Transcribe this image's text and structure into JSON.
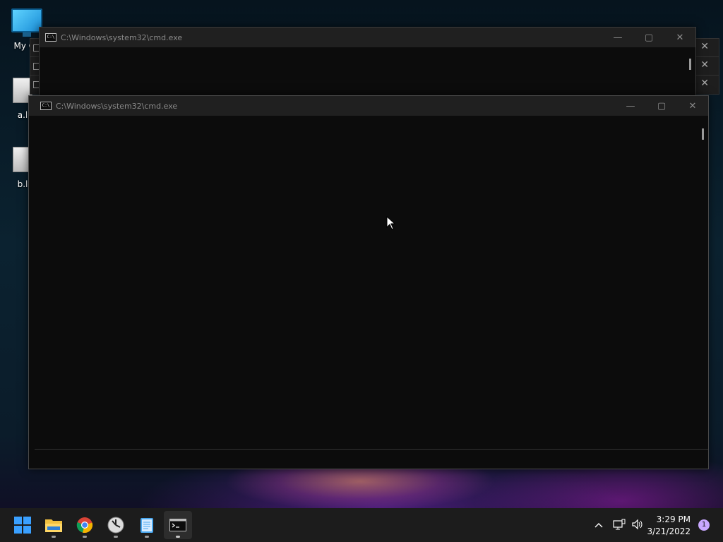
{
  "desktop": {
    "icons": [
      {
        "label": "My Co"
      },
      {
        "label": "a.l"
      },
      {
        "label": "b.l"
      }
    ]
  },
  "windows": {
    "back_title": "C:\\Windows\\system32\\cmd.exe",
    "front_title": "C:\\Windows\\system32\\cmd.exe",
    "minimize": "—",
    "maximize": "▢",
    "close": "✕"
  },
  "taskbar": {
    "apps": [
      "start",
      "file-explorer",
      "chrome",
      "clock-app",
      "notepad",
      "command-prompt"
    ],
    "time": "3:29 PM",
    "date": "3/21/2022",
    "notification_count": "1"
  },
  "colors": {
    "accent": "#0078d4",
    "terminal_bg": "#0c0c0c",
    "titlebar_bg": "#202020",
    "taskbar_bg": "#1c1c1c"
  }
}
